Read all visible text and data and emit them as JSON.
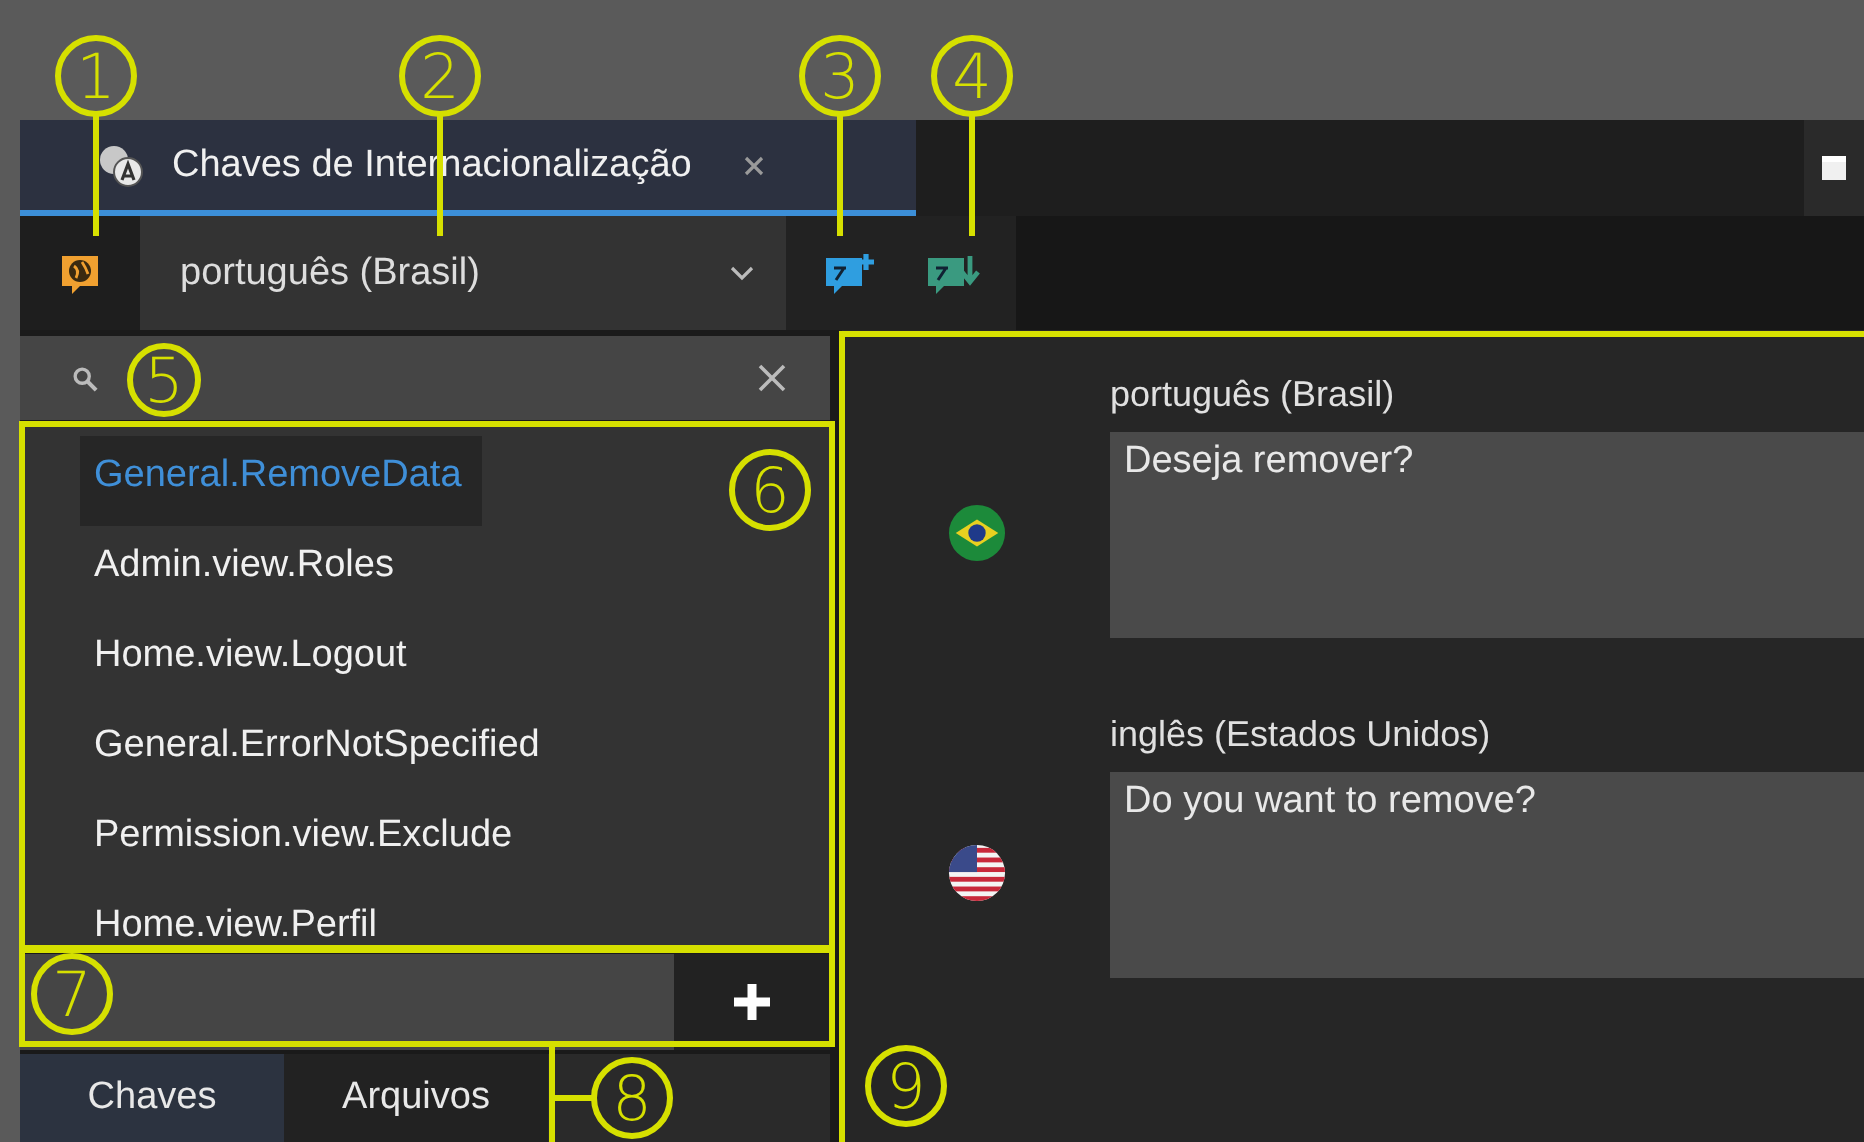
{
  "annotations": [
    {
      "label": "1"
    },
    {
      "label": "2"
    },
    {
      "label": "3"
    },
    {
      "label": "4"
    },
    {
      "label": "5"
    },
    {
      "label": "6"
    },
    {
      "label": "7"
    },
    {
      "label": "8"
    },
    {
      "label": "9"
    }
  ],
  "tab": {
    "title": "Chaves de Internacionalização",
    "selected": true
  },
  "language_select": {
    "value": "português (Brasil)"
  },
  "keys": [
    {
      "label": "General.RemoveData",
      "selected": true
    },
    {
      "label": "Admin.view.Roles",
      "selected": false
    },
    {
      "label": "Home.view.Logout",
      "selected": false
    },
    {
      "label": "General.ErrorNotSpecified",
      "selected": false
    },
    {
      "label": "Permission.view.Exclude",
      "selected": false
    },
    {
      "label": "Home.view.Perfil",
      "selected": false
    }
  ],
  "bottom_tabs": [
    {
      "label": "Chaves",
      "selected": true
    },
    {
      "label": "Arquivos",
      "selected": false
    }
  ],
  "translations": [
    {
      "language": "português (Brasil)",
      "value": "Deseja remover?",
      "kind": "br"
    },
    {
      "language": "inglês (Estados Unidos)",
      "value": "Do you want to remove?",
      "kind": "us"
    }
  ]
}
